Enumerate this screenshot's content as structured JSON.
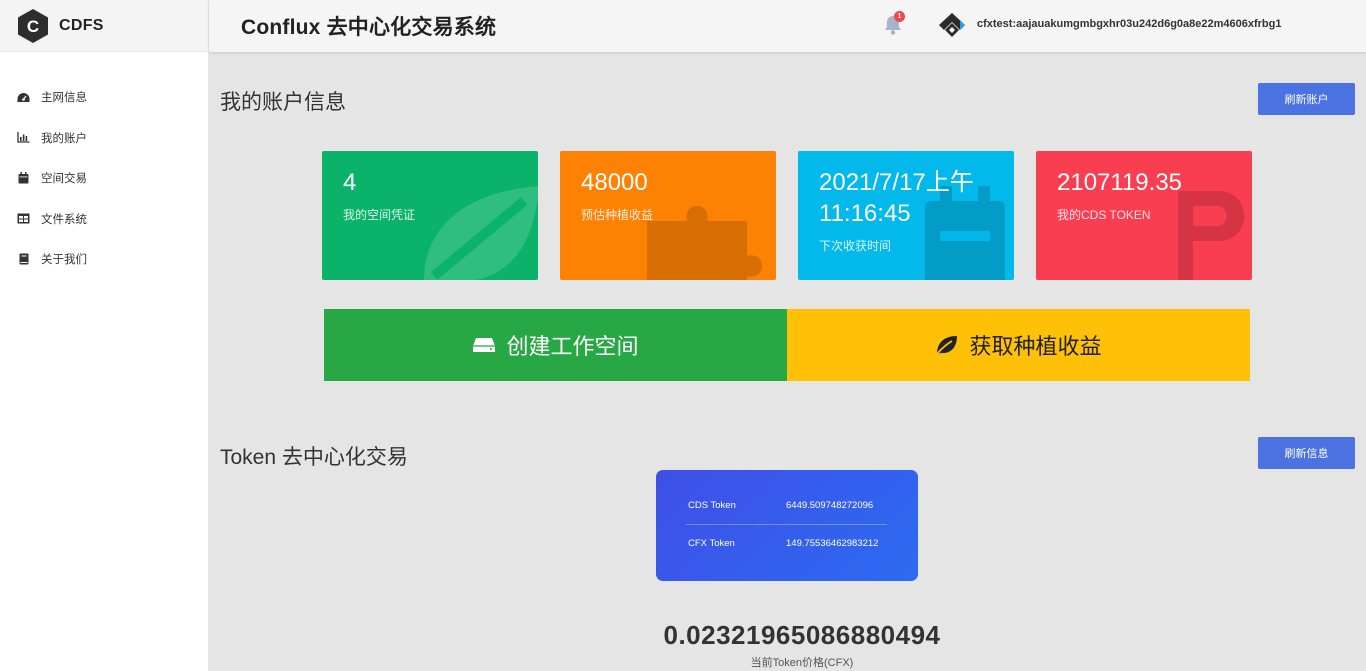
{
  "brand": {
    "name": "CDFS",
    "logo_letter": "C",
    "icon": "cdfs-hexagon-logo"
  },
  "header": {
    "title": "Conflux 去中心化交易系统",
    "notifications": {
      "icon": "bell-icon",
      "count": "1"
    },
    "wallet": {
      "icon": "conflux-logo",
      "address": "cfxtest:aajauakumgmbgxhr03u242d6g0a8e22m4606xfrbg1"
    }
  },
  "sidebar": {
    "items": [
      {
        "label": "主网信息",
        "icon": "dashboard-gauge-icon"
      },
      {
        "label": "我的账户",
        "icon": "bar-chart-icon"
      },
      {
        "label": "空间交易",
        "icon": "calendar-icon"
      },
      {
        "label": "文件系统",
        "icon": "table-icon"
      },
      {
        "label": "关于我们",
        "icon": "book-icon"
      }
    ]
  },
  "account": {
    "title": "我的账户信息",
    "refresh_label": "刷新账户",
    "cards": [
      {
        "value": "4",
        "label": "我的空间凭证",
        "color": "#0bb36a",
        "icon": "leaf-icon"
      },
      {
        "value": "48000",
        "label": "预估种植收益",
        "color": "#fd8204",
        "icon": "puzzle-icon"
      },
      {
        "value": "2021/7/17上午11:16:45",
        "value_line1": "2021/7/17上午",
        "value_line2": "11:16:45",
        "label": "下次收获时间",
        "color": "#03b8ea",
        "icon": "calendar-icon"
      },
      {
        "value": "2107119.35",
        "label": "我的CDS TOKEN",
        "color": "#fa3e51",
        "icon": "ruble-icon"
      }
    ],
    "actions": [
      {
        "label": "创建工作空间",
        "icon": "hdd-icon",
        "color": "#28a745"
      },
      {
        "label": "获取种植收益",
        "icon": "leaf-icon",
        "color": "#ffc107"
      }
    ]
  },
  "token": {
    "title": "Token 去中心化交易",
    "refresh_label": "刷新信息",
    "rows": [
      {
        "name": "CDS Token",
        "value": "6449.509748272096"
      },
      {
        "name": "CFX Token",
        "value": "149.75536462983212"
      }
    ],
    "price": "0.02321965086880494",
    "price_label": "当前Token价格(CFX)"
  }
}
